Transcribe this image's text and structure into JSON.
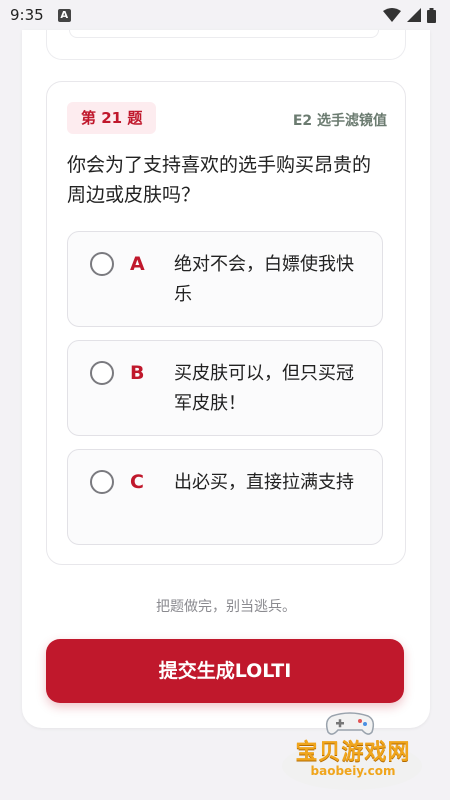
{
  "status_bar": {
    "time": "9:35",
    "notification_icon": "A"
  },
  "question": {
    "number_label": "第 21 题",
    "tag": "E2 选手滤镜值",
    "text": "你会为了支持喜欢的选手购买昂贵的周边或皮肤吗？",
    "options": [
      {
        "letter": "A",
        "text": "绝对不会，白嫖使我快乐"
      },
      {
        "letter": "B",
        "text": "买皮肤可以，但只买冠军皮肤！"
      },
      {
        "letter": "C",
        "text": "出必买，直接拉满支持"
      }
    ]
  },
  "hint": "把题做完，别当逃兵。",
  "submit_label": "提交生成LOLTI",
  "watermark": {
    "title": "宝贝游戏网",
    "url": "baobeiy.com"
  },
  "colors": {
    "accent": "#c0182c",
    "badge_bg": "#fdecef",
    "tag": "#6b7b70",
    "background": "#f3f2f5"
  }
}
